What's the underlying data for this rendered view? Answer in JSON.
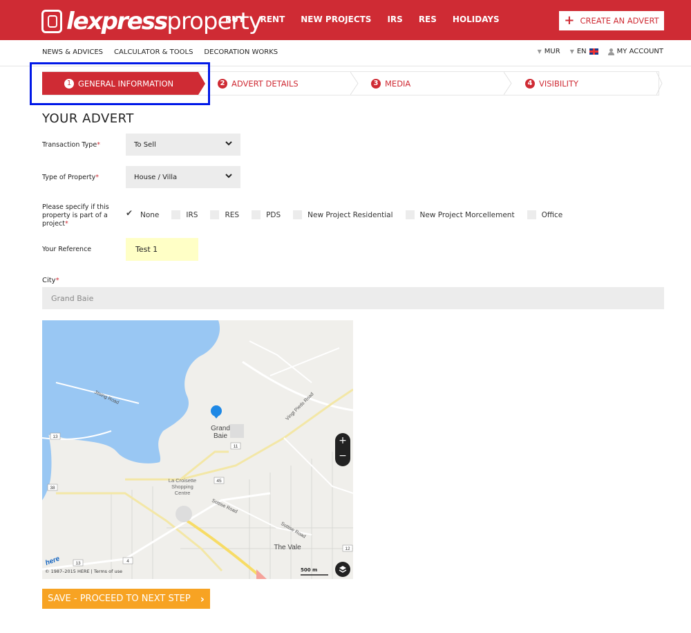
{
  "header": {
    "logo_bold": "lexpress",
    "logo_thin": "property",
    "nav": [
      "BUY",
      "RENT",
      "NEW PROJECTS",
      "IRS",
      "RES",
      "HOLIDAYS"
    ],
    "create_advert": "CREATE AN ADVERT"
  },
  "subnav": {
    "links": [
      "NEWS & ADVICES",
      "CALCULATOR & TOOLS",
      "DECORATION WORKS"
    ],
    "currency": "MUR",
    "language": "EN",
    "account": "MY ACCOUNT"
  },
  "steps": [
    {
      "num": "1",
      "label": "GENERAL INFORMATION",
      "active": true
    },
    {
      "num": "2",
      "label": "ADVERT DETAILS",
      "active": false
    },
    {
      "num": "3",
      "label": "MEDIA",
      "active": false
    },
    {
      "num": "4",
      "label": "VISIBILITY",
      "active": false
    }
  ],
  "form": {
    "title": "YOUR ADVERT",
    "transaction_type": {
      "label": "Transaction Type",
      "value": "To Sell"
    },
    "property_type": {
      "label": "Type of Property",
      "value": "House / Villa"
    },
    "project": {
      "label_lines": [
        "Please specify if this",
        "property is part of a",
        "project"
      ],
      "options": [
        {
          "label": "None",
          "checked": true
        },
        {
          "label": "IRS",
          "checked": false
        },
        {
          "label": "RES",
          "checked": false
        },
        {
          "label": "PDS",
          "checked": false
        },
        {
          "label": "New Project Residential",
          "checked": false
        },
        {
          "label": "New Project Morcellement",
          "checked": false
        },
        {
          "label": "Office",
          "checked": false
        }
      ]
    },
    "reference": {
      "label": "Your Reference",
      "value": "Test 1"
    },
    "city": {
      "label": "City",
      "value": "Grand Baie"
    },
    "required_mark": "*"
  },
  "map": {
    "labels": [
      "Grand",
      "Baie",
      "Jitsing Road",
      "Vingt Pieds Road",
      "La Croisette",
      "Shopping",
      "Centre",
      "Sottise Road",
      "Sottise Road",
      "The Vale"
    ],
    "road_numbers": [
      "13",
      "11",
      "45",
      "38",
      "13",
      "4",
      "12"
    ],
    "zoom_in": "+",
    "zoom_out": "−",
    "copyright": "© 1987–2015 HERE | Terms of use",
    "scale": "500 m",
    "brand": "here"
  },
  "save_button": "SAVE - PROCEED TO NEXT STEP",
  "colors": {
    "brand_red": "#cf2b34",
    "highlight_blue": "#0018e8",
    "button_orange": "#f7a323"
  }
}
